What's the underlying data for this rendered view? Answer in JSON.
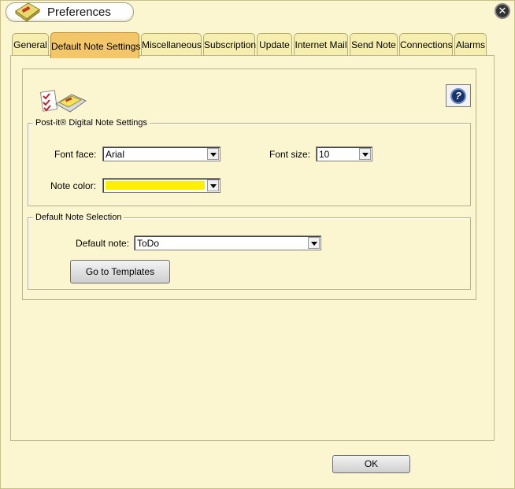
{
  "window": {
    "title": "Preferences",
    "close_glyph": "✕"
  },
  "tabs": [
    {
      "label": "General"
    },
    {
      "label": "Default Note Settings",
      "active": true
    },
    {
      "label": "Miscellaneous"
    },
    {
      "label": "Subscription"
    },
    {
      "label": "Update"
    },
    {
      "label": "Internet Mail"
    },
    {
      "label": "Send Note"
    },
    {
      "label": "Connections"
    },
    {
      "label": "Alarms"
    }
  ],
  "help": {
    "glyph": "?"
  },
  "note_settings": {
    "legend": "Post-it® Digital Note Settings",
    "font_face_label": "Font face:",
    "font_face_value": "Arial",
    "font_size_label": "Font size:",
    "font_size_value": "10",
    "note_color_label": "Note color:",
    "note_color": "#ffef00"
  },
  "default_selection": {
    "legend": "Default Note Selection",
    "default_note_label": "Default note:",
    "default_note_value": "ToDo",
    "templates_button": "Go to Templates"
  },
  "footer": {
    "ok_button": "OK"
  },
  "icons": {
    "title_logo": "post-it-notepad-icon",
    "notes_logo": "post-it-notes-checklist-icon",
    "help": "help-question-icon",
    "close": "close-icon"
  }
}
